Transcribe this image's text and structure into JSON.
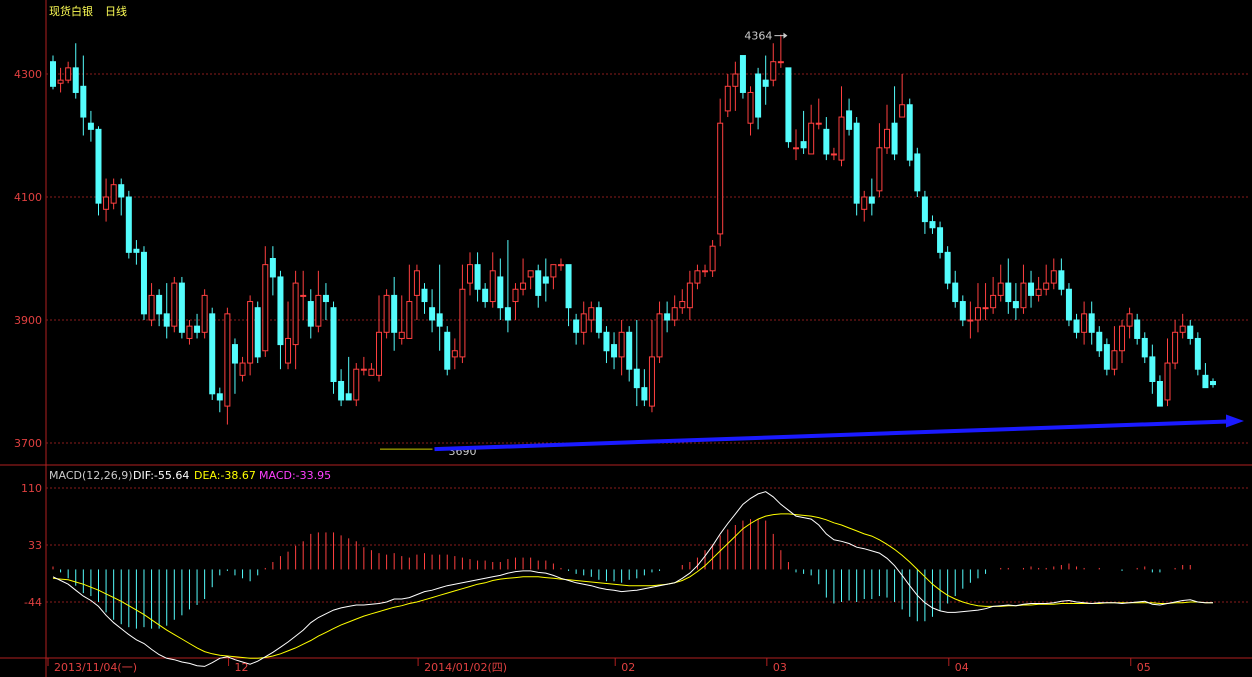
{
  "header": {
    "instrument": "现货白银",
    "period": "日线"
  },
  "colors": {
    "up": "#ff4040",
    "down": "#54fcfc",
    "axis": "#b02020",
    "grid": "#8a1c1c",
    "dif": "#ffffff",
    "dea": "#ffff00",
    "macd_label": "#ff40ff",
    "arrow": "#1a1aff"
  },
  "chart_data": [
    {
      "type": "candlestick",
      "name": "现货白银 日线",
      "y_ticks": [
        "4300",
        "4100",
        "3900",
        "3700"
      ],
      "ylim": [
        3675,
        4370
      ],
      "grid": true,
      "annotations": {
        "high_label": "4364",
        "low_label": "3690"
      },
      "trendline": {
        "from": 3690,
        "to": 3735,
        "style": "blue arrow"
      },
      "candles": [
        [
          4320,
          4280,
          4330,
          4275
        ],
        [
          4285,
          4290,
          4310,
          4270
        ],
        [
          4290,
          4310,
          4320,
          4285
        ],
        [
          4310,
          4270,
          4350,
          4260
        ],
        [
          4280,
          4230,
          4330,
          4200
        ],
        [
          4220,
          4210,
          4240,
          4190
        ],
        [
          4210,
          4090,
          4215,
          4070
        ],
        [
          4080,
          4100,
          4130,
          4060
        ],
        [
          4090,
          4120,
          4130,
          4080
        ],
        [
          4120,
          4100,
          4130,
          4070
        ],
        [
          4100,
          4010,
          4110,
          4000
        ],
        [
          4015,
          4010,
          4030,
          3990
        ],
        [
          4010,
          3910,
          4020,
          3900
        ],
        [
          3900,
          3940,
          3960,
          3890
        ],
        [
          3940,
          3910,
          3950,
          3890
        ],
        [
          3910,
          3890,
          3960,
          3870
        ],
        [
          3890,
          3960,
          3970,
          3880
        ],
        [
          3960,
          3880,
          3970,
          3870
        ],
        [
          3870,
          3890,
          3900,
          3860
        ],
        [
          3890,
          3880,
          3910,
          3870
        ],
        [
          3880,
          3940,
          3950,
          3870
        ],
        [
          3910,
          3780,
          3920,
          3770
        ],
        [
          3780,
          3770,
          3790,
          3750
        ],
        [
          3760,
          3910,
          3920,
          3730
        ],
        [
          3860,
          3830,
          3870,
          3780
        ],
        [
          3810,
          3830,
          3840,
          3800
        ],
        [
          3830,
          3930,
          3940,
          3810
        ],
        [
          3920,
          3840,
          3930,
          3830
        ],
        [
          3850,
          3990,
          4020,
          3840
        ],
        [
          4000,
          3970,
          4020,
          3940
        ],
        [
          3970,
          3860,
          3980,
          3820
        ],
        [
          3830,
          3870,
          3930,
          3820
        ],
        [
          3860,
          3960,
          3980,
          3820
        ],
        [
          3940,
          3940,
          3980,
          3900
        ],
        [
          3930,
          3890,
          3950,
          3870
        ],
        [
          3890,
          3940,
          3980,
          3880
        ],
        [
          3940,
          3930,
          3960,
          3900
        ],
        [
          3920,
          3800,
          3930,
          3780
        ],
        [
          3800,
          3770,
          3820,
          3760
        ],
        [
          3780,
          3770,
          3840,
          3770
        ],
        [
          3770,
          3820,
          3830,
          3760
        ],
        [
          3820,
          3820,
          3840,
          3810
        ],
        [
          3810,
          3820,
          3830,
          3810
        ],
        [
          3810,
          3880,
          3940,
          3800
        ],
        [
          3880,
          3940,
          3950,
          3870
        ],
        [
          3940,
          3880,
          3970,
          3850
        ],
        [
          3870,
          3880,
          3940,
          3860
        ],
        [
          3870,
          3930,
          3990,
          3870
        ],
        [
          3940,
          3980,
          3990,
          3900
        ],
        [
          3950,
          3930,
          3960,
          3910
        ],
        [
          3920,
          3900,
          3950,
          3880
        ],
        [
          3910,
          3890,
          3990,
          3850
        ],
        [
          3880,
          3820,
          3890,
          3810
        ],
        [
          3840,
          3850,
          3870,
          3820
        ],
        [
          3840,
          3950,
          3990,
          3830
        ],
        [
          3960,
          3990,
          4010,
          3940
        ],
        [
          3990,
          3950,
          4010,
          3930
        ],
        [
          3950,
          3930,
          3960,
          3920
        ],
        [
          3930,
          3980,
          4010,
          3920
        ],
        [
          3970,
          3920,
          4000,
          3900
        ],
        [
          3920,
          3900,
          4030,
          3880
        ],
        [
          3930,
          3950,
          3960,
          3900
        ],
        [
          3950,
          3960,
          4000,
          3940
        ],
        [
          3970,
          3980,
          3980,
          3950
        ],
        [
          3980,
          3940,
          3990,
          3920
        ],
        [
          3970,
          3960,
          4000,
          3930
        ],
        [
          3970,
          3990,
          3990,
          3950
        ],
        [
          3990,
          3990,
          4000,
          3980
        ],
        [
          3990,
          3920,
          3990,
          3890
        ],
        [
          3900,
          3880,
          3910,
          3860
        ],
        [
          3880,
          3910,
          3930,
          3860
        ],
        [
          3900,
          3920,
          3930,
          3880
        ],
        [
          3920,
          3880,
          3930,
          3870
        ],
        [
          3880,
          3850,
          3890,
          3830
        ],
        [
          3860,
          3840,
          3880,
          3820
        ],
        [
          3840,
          3880,
          3900,
          3810
        ],
        [
          3880,
          3820,
          3890,
          3800
        ],
        [
          3820,
          3790,
          3900,
          3760
        ],
        [
          3790,
          3770,
          3820,
          3760
        ],
        [
          3760,
          3840,
          3900,
          3750
        ],
        [
          3840,
          3910,
          3930,
          3830
        ],
        [
          3910,
          3900,
          3930,
          3880
        ],
        [
          3900,
          3920,
          3940,
          3890
        ],
        [
          3920,
          3930,
          3950,
          3910
        ],
        [
          3920,
          3960,
          3980,
          3900
        ],
        [
          3960,
          3980,
          3990,
          3950
        ],
        [
          3980,
          3980,
          3990,
          3970
        ],
        [
          3980,
          4020,
          4030,
          3970
        ],
        [
          4040,
          4220,
          4260,
          4020
        ],
        [
          4240,
          4280,
          4300,
          4230
        ],
        [
          4280,
          4300,
          4320,
          4240
        ],
        [
          4330,
          4270,
          4330,
          4260
        ],
        [
          4220,
          4270,
          4280,
          4200
        ],
        [
          4300,
          4230,
          4310,
          4210
        ],
        [
          4290,
          4280,
          4330,
          4250
        ],
        [
          4290,
          4320,
          4350,
          4280
        ],
        [
          4320,
          4320,
          4364,
          4310
        ],
        [
          4310,
          4190,
          4310,
          4180
        ],
        [
          4180,
          4180,
          4210,
          4160
        ],
        [
          4190,
          4180,
          4240,
          4170
        ],
        [
          4170,
          4220,
          4250,
          4190
        ],
        [
          4220,
          4220,
          4260,
          4210
        ],
        [
          4210,
          4170,
          4230,
          4160
        ],
        [
          4170,
          4170,
          4180,
          4160
        ],
        [
          4160,
          4230,
          4280,
          4150
        ],
        [
          4240,
          4210,
          4260,
          4200
        ],
        [
          4220,
          4090,
          4230,
          4070
        ],
        [
          4080,
          4100,
          4110,
          4060
        ],
        [
          4100,
          4090,
          4130,
          4070
        ],
        [
          4110,
          4180,
          4220,
          4100
        ],
        [
          4180,
          4210,
          4250,
          4170
        ],
        [
          4220,
          4170,
          4280,
          4160
        ],
        [
          4230,
          4250,
          4300,
          4230
        ],
        [
          4250,
          4160,
          4260,
          4150
        ],
        [
          4170,
          4110,
          4180,
          4100
        ],
        [
          4100,
          4060,
          4110,
          4040
        ],
        [
          4060,
          4050,
          4070,
          4040
        ],
        [
          4050,
          4010,
          4060,
          4000
        ],
        [
          4010,
          3960,
          4020,
          3950
        ],
        [
          3960,
          3930,
          3980,
          3920
        ],
        [
          3930,
          3900,
          3940,
          3890
        ],
        [
          3900,
          3900,
          3930,
          3870
        ],
        [
          3900,
          3920,
          3960,
          3880
        ],
        [
          3920,
          3920,
          3960,
          3900
        ],
        [
          3920,
          3940,
          3970,
          3910
        ],
        [
          3940,
          3960,
          3990,
          3930
        ],
        [
          3960,
          3930,
          4000,
          3910
        ],
        [
          3930,
          3920,
          3960,
          3900
        ],
        [
          3920,
          3960,
          3990,
          3910
        ],
        [
          3960,
          3940,
          3980,
          3920
        ],
        [
          3940,
          3950,
          3970,
          3930
        ],
        [
          3950,
          3960,
          3990,
          3940
        ],
        [
          3960,
          3980,
          4000,
          3950
        ],
        [
          3980,
          3950,
          4000,
          3940
        ],
        [
          3950,
          3900,
          3960,
          3890
        ],
        [
          3900,
          3880,
          3910,
          3870
        ],
        [
          3880,
          3910,
          3930,
          3860
        ],
        [
          3910,
          3880,
          3930,
          3860
        ],
        [
          3880,
          3850,
          3890,
          3840
        ],
        [
          3860,
          3820,
          3870,
          3810
        ],
        [
          3820,
          3850,
          3890,
          3810
        ],
        [
          3850,
          3890,
          3900,
          3830
        ],
        [
          3890,
          3910,
          3920,
          3870
        ],
        [
          3900,
          3870,
          3910,
          3860
        ],
        [
          3870,
          3840,
          3880,
          3830
        ],
        [
          3840,
          3800,
          3860,
          3780
        ],
        [
          3800,
          3760,
          3810,
          3760
        ],
        [
          3770,
          3830,
          3870,
          3760
        ],
        [
          3830,
          3880,
          3900,
          3820
        ],
        [
          3880,
          3890,
          3910,
          3870
        ],
        [
          3890,
          3870,
          3900,
          3860
        ],
        [
          3870,
          3820,
          3880,
          3810
        ],
        [
          3810,
          3790,
          3830,
          3790
        ],
        [
          3800,
          3795,
          3805,
          3790
        ]
      ]
    },
    {
      "type": "macd",
      "title": "MACD(12,26,9)",
      "values_label": {
        "dif": "DIF:-55.64",
        "dea": "DEA:-38.67",
        "macd": "MACD:-33.95"
      },
      "y_ticks": [
        "110",
        "33",
        "-44"
      ],
      "ylim": [
        -140,
        150
      ],
      "x_ticks": [
        "2013/11/04(一)",
        "12",
        "2014/01/02(四)",
        "02",
        "03",
        "04",
        "05"
      ],
      "dif": [
        -10,
        -15,
        -20,
        -28,
        -36,
        -42,
        -50,
        -62,
        -72,
        -80,
        -88,
        -95,
        -100,
        -108,
        -115,
        -120,
        -122,
        -125,
        -127,
        -130,
        -131,
        -126,
        -120,
        -118,
        -122,
        -125,
        -128,
        -124,
        -118,
        -112,
        -105,
        -98,
        -90,
        -82,
        -72,
        -65,
        -60,
        -55,
        -52,
        -50,
        -48,
        -48,
        -47,
        -46,
        -44,
        -40,
        -40,
        -38,
        -34,
        -30,
        -28,
        -25,
        -22,
        -20,
        -18,
        -16,
        -14,
        -12,
        -10,
        -8,
        -5,
        -3,
        -2,
        -2,
        -4,
        -5,
        -8,
        -12,
        -15,
        -18,
        -20,
        -22,
        -25,
        -27,
        -28,
        -30,
        -29,
        -28,
        -26,
        -24,
        -22,
        -20,
        -18,
        -12,
        -5,
        5,
        18,
        32,
        48,
        62,
        75,
        88,
        96,
        102,
        105,
        98,
        88,
        80,
        72,
        70,
        68,
        60,
        48,
        40,
        38,
        35,
        30,
        28,
        25,
        22,
        15,
        5,
        -8,
        -22,
        -35,
        -45,
        -52,
        -56,
        -58,
        -58,
        -57,
        -56,
        -55,
        -53,
        -50,
        -49,
        -48,
        -49,
        -47,
        -46,
        -46,
        -46,
        -45,
        -43,
        -42,
        -44,
        -45,
        -46,
        -45,
        -45,
        -45,
        -46,
        -45,
        -44,
        -43,
        -47,
        -48,
        -46,
        -44,
        -42,
        -41,
        -44,
        -45,
        -45
      ],
      "dea": [
        -12,
        -13,
        -14,
        -17,
        -20,
        -24,
        -28,
        -33,
        -38,
        -43,
        -49,
        -55,
        -61,
        -68,
        -75,
        -82,
        -88,
        -94,
        -100,
        -106,
        -111,
        -114,
        -116,
        -117,
        -118,
        -119,
        -120,
        -120,
        -119,
        -117,
        -114,
        -110,
        -106,
        -101,
        -96,
        -90,
        -85,
        -80,
        -75,
        -71,
        -67,
        -63,
        -60,
        -57,
        -54,
        -51,
        -49,
        -46,
        -44,
        -41,
        -38,
        -35,
        -32,
        -29,
        -26,
        -23,
        -20,
        -18,
        -15,
        -13,
        -12,
        -11,
        -10,
        -10,
        -10,
        -11,
        -12,
        -13,
        -14,
        -15,
        -16,
        -17,
        -18,
        -19,
        -20,
        -21,
        -22,
        -22,
        -22,
        -22,
        -21,
        -20,
        -18,
        -15,
        -10,
        -3,
        5,
        15,
        25,
        35,
        45,
        55,
        62,
        68,
        72,
        74,
        75,
        75,
        74,
        73,
        72,
        70,
        67,
        63,
        60,
        56,
        52,
        48,
        45,
        40,
        34,
        27,
        19,
        10,
        0,
        -10,
        -20,
        -28,
        -35,
        -40,
        -44,
        -47,
        -49,
        -50,
        -50,
        -50,
        -49,
        -49,
        -48,
        -48,
        -47,
        -47,
        -47,
        -46,
        -46,
        -46,
        -46,
        -46,
        -46,
        -45,
        -45,
        -45,
        -45,
        -45,
        -45,
        -45,
        -46,
        -46,
        -45,
        -45,
        -44,
        -44,
        -45,
        -45
      ]
    }
  ]
}
